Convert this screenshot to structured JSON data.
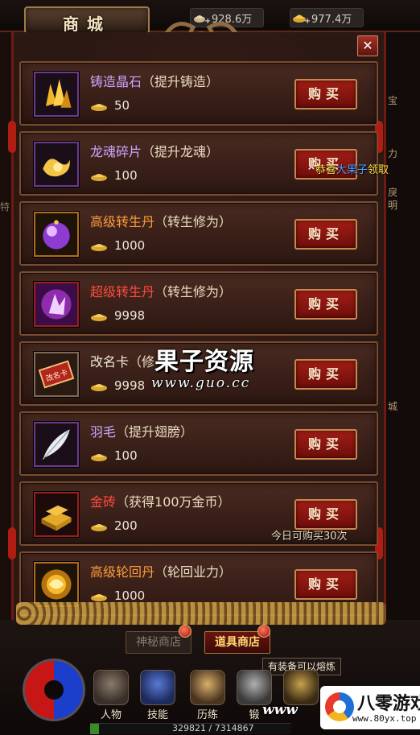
{
  "header": {
    "title": "商城",
    "currency_ingot": "928.6万",
    "currency_gold": "977.4万"
  },
  "items": [
    {
      "name": "铸造晶石",
      "desc": "（提升铸造）",
      "price": "50",
      "name_color": "purple",
      "frame": "purple",
      "icon": "crystal-icon"
    },
    {
      "name": "龙魂碎片",
      "desc": "（提升龙魂）",
      "price": "100",
      "name_color": "purple",
      "frame": "purple",
      "icon": "dragon-soul-icon"
    },
    {
      "name": "高级转生丹",
      "desc": "（转生修为）",
      "price": "1000",
      "name_color": "orange",
      "frame": "orange",
      "icon": "purple-orb-icon"
    },
    {
      "name": "超级转生丹",
      "desc": "（转生修为）",
      "price": "9998",
      "name_color": "red",
      "frame": "red",
      "icon": "magic-creature-icon"
    },
    {
      "name": "改名卡",
      "desc": "（修",
      "price": "9998",
      "name_color": "white",
      "frame": "plain",
      "icon": "rename-card-icon",
      "card_text": "改名卡"
    },
    {
      "name": "羽毛",
      "desc": "（提升翅膀）",
      "price": "100",
      "name_color": "purple",
      "frame": "purple",
      "icon": "feather-icon"
    },
    {
      "name": "金砖",
      "desc": "（获得100万金币）",
      "price": "200",
      "name_color": "red",
      "frame": "red",
      "icon": "gold-brick-icon"
    },
    {
      "name": "高级轮回丹",
      "desc": "（轮回业力）",
      "price": "1000",
      "name_color": "orange",
      "frame": "orange",
      "icon": "golden-orb-icon"
    }
  ],
  "buy_label": "购买",
  "notices": {
    "congrats_prefix": "恭喜",
    "congrats_name": "大果子",
    "congrats_suffix": "领取",
    "daily_limit": "今日可购买30次"
  },
  "watermark": {
    "title": "果子资源",
    "url": "www.guo.cc"
  },
  "tabs": {
    "mystery": "神秘商店",
    "items": "道具商店"
  },
  "tooltip": "有装备可以熔炼",
  "skills": [
    "人物",
    "技能",
    "历练",
    "锻"
  ],
  "exp": {
    "text": "329821 / 7314867",
    "fraction": 0.045
  },
  "right_edge_tags": [
    "宝",
    "力",
    "戾",
    "明",
    "城"
  ],
  "left_edge_tag": "特",
  "site_logo": {
    "name": "八零游戏",
    "url": "www.80yx.top"
  },
  "bottom_watermark": "www",
  "colors": {
    "purple_name": "#c8a7ff",
    "orange_name": "#ff9b3b",
    "red_name": "#ff4b3c",
    "buy_button": "#8e1612",
    "highlight_yellow": "#ffe34a",
    "highlight_blue": "#49a0ff"
  }
}
